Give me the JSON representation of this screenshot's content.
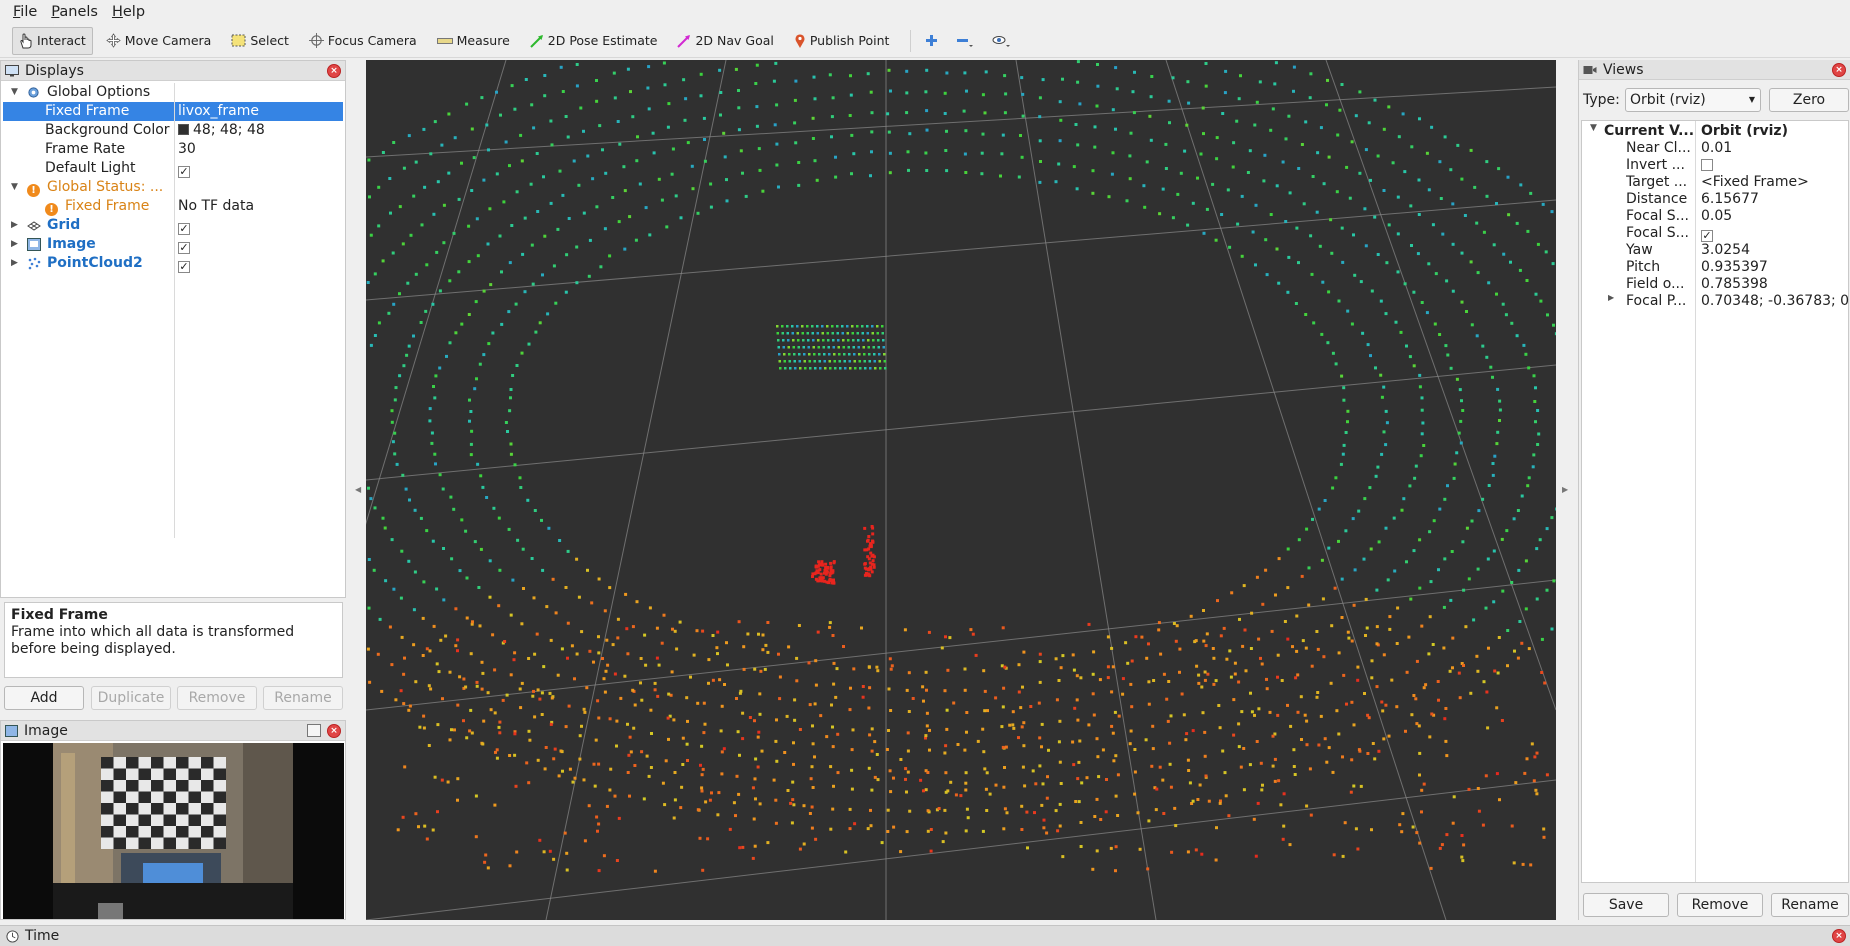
{
  "menubar": {
    "items": [
      {
        "label": "File",
        "accel": "F",
        "rest": "ile"
      },
      {
        "label": "Panels",
        "accel": "P",
        "rest": "anels"
      },
      {
        "label": "Help",
        "accel": "H",
        "rest": "elp"
      }
    ]
  },
  "toolbar": {
    "tools": [
      {
        "label": "Interact",
        "icon": "hand-cursor-icon",
        "active": true
      },
      {
        "label": "Move Camera",
        "icon": "move-arrows-icon"
      },
      {
        "label": "Select",
        "icon": "select-box-icon"
      },
      {
        "label": "Focus Camera",
        "icon": "focus-target-icon"
      },
      {
        "label": "Measure",
        "icon": "ruler-icon"
      },
      {
        "label": "2D Pose Estimate",
        "icon": "green-arrow-icon"
      },
      {
        "label": "2D Nav Goal",
        "icon": "magenta-arrow-icon"
      },
      {
        "label": "Publish Point",
        "icon": "map-pin-icon"
      }
    ],
    "extra_icons": [
      "plus-icon",
      "minus-icon",
      "eye-icon"
    ]
  },
  "displays": {
    "title": "Displays",
    "rows": [
      {
        "name": "Global Options",
        "value": ""
      },
      {
        "name": "Fixed Frame",
        "value": "livox_frame"
      },
      {
        "name": "Background Color",
        "value": "48; 48; 48"
      },
      {
        "name": "Frame Rate",
        "value": "30"
      },
      {
        "name": "Default Light",
        "value": "✓"
      },
      {
        "name": "Global Status: ...",
        "value": ""
      },
      {
        "name": "Fixed Frame",
        "value": "No TF data"
      },
      {
        "name": "Grid",
        "value": "✓"
      },
      {
        "name": "Image",
        "value": "✓"
      },
      {
        "name": "PointCloud2",
        "value": "✓"
      }
    ],
    "description_title": "Fixed Frame",
    "description_text": "Frame into which all data is transformed before being displayed.",
    "buttons": {
      "add": "Add",
      "duplicate": "Duplicate",
      "remove": "Remove",
      "rename": "Rename"
    }
  },
  "image_panel": {
    "title": "Image"
  },
  "views": {
    "title": "Views",
    "type_label": "Type:",
    "type_value": "Orbit (rviz)",
    "zero_label": "Zero",
    "rows": [
      {
        "name": "Current V...",
        "value": "Orbit (rviz)"
      },
      {
        "name": "Near Cl...",
        "value": "0.01"
      },
      {
        "name": "Invert ...",
        "value": ""
      },
      {
        "name": "Target ...",
        "value": "<Fixed Frame>"
      },
      {
        "name": "Distance",
        "value": "6.15677"
      },
      {
        "name": "Focal S...",
        "value": "0.05"
      },
      {
        "name": "Focal S...",
        "value": "✓"
      },
      {
        "name": "Yaw",
        "value": "3.0254"
      },
      {
        "name": "Pitch",
        "value": "0.935397"
      },
      {
        "name": "Field o...",
        "value": "0.785398"
      },
      {
        "name": "Focal P...",
        "value": "0.70348; -0.36783; 0..."
      }
    ],
    "buttons": {
      "save": "Save",
      "remove": "Remove",
      "rename": "Rename"
    }
  },
  "time_panel": {
    "title": "Time"
  },
  "colors": {
    "viewport_bg": "#303030",
    "selection": "#3584e4",
    "warning": "#f08a1c",
    "display_name_blue": "#1f6fc4",
    "close_red": "#e04545"
  }
}
